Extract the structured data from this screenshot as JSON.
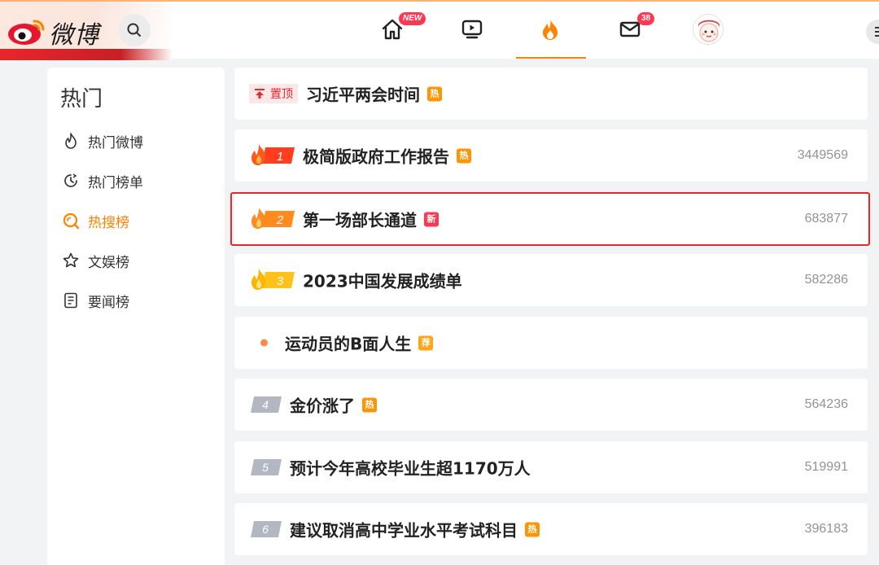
{
  "header": {
    "logo_text": "微博",
    "nav": [
      {
        "icon": "home-icon",
        "badge": "NEW"
      },
      {
        "icon": "video-icon"
      },
      {
        "icon": "hot-fire-icon"
      },
      {
        "icon": "mail-icon",
        "badge": "38"
      },
      {
        "icon": "avatar"
      }
    ]
  },
  "sidebar": {
    "title": "热门",
    "items": [
      {
        "label": "热门微博",
        "icon": "fire-outline-icon",
        "active": false
      },
      {
        "label": "热门榜单",
        "icon": "clock-icon",
        "active": false
      },
      {
        "label": "热搜榜",
        "icon": "search-hot-icon",
        "active": true
      },
      {
        "label": "文娱榜",
        "icon": "star-icon",
        "active": false
      },
      {
        "label": "要闻榜",
        "icon": "news-icon",
        "active": false
      }
    ]
  },
  "hot_list": {
    "pinned": {
      "pin_label": "置顶",
      "title": "习近平两会时间",
      "tag": "热"
    },
    "items": [
      {
        "rank": "1",
        "title": "极简版政府工作报告",
        "tag": "热",
        "count": "3449569"
      },
      {
        "rank": "2",
        "title": "第一场部长通道",
        "tag": "新",
        "count": "683877"
      },
      {
        "rank": "3",
        "title": "2023中国发展成绩单",
        "tag": "",
        "count": "582286"
      },
      {
        "rank": "",
        "title": "运动员的B面人生",
        "tag": "荐",
        "count": ""
      },
      {
        "rank": "4",
        "title": "金价涨了",
        "tag": "热",
        "count": "564236"
      },
      {
        "rank": "5",
        "title": "预计今年高校毕业生超1170万人",
        "tag": "",
        "count": "519991"
      },
      {
        "rank": "6",
        "title": "建议取消高中学业水平考试科目",
        "tag": "热",
        "count": "396183"
      }
    ]
  },
  "colors": {
    "accent": "#ff8200",
    "hot_tag": "#ff9406",
    "new_tag": "#ff3852",
    "highlight": "#e8262c"
  }
}
